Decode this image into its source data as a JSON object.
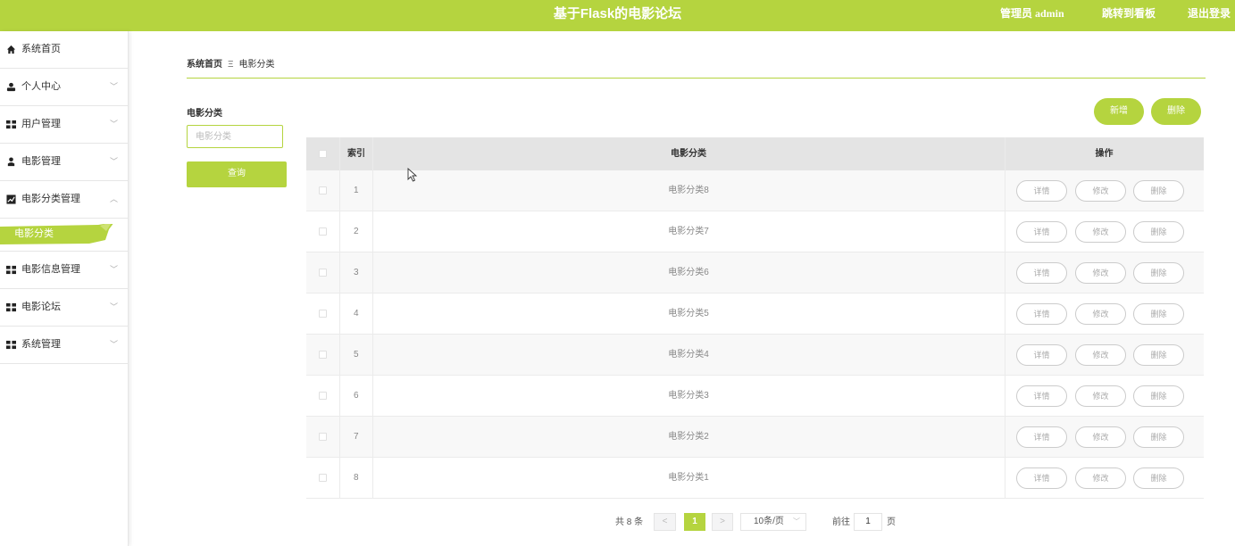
{
  "header": {
    "title": "基于Flask的电影论坛",
    "admin_label": "管理员 admin",
    "dashboard_link": "跳转到看板",
    "logout_link": "退出登录",
    "brand_color": "#b5d43f"
  },
  "sidebar": {
    "items": [
      {
        "label": "系统首页",
        "icon": "home-icon",
        "expandable": false
      },
      {
        "label": "个人中心",
        "icon": "user-icon",
        "expandable": true
      },
      {
        "label": "用户管理",
        "icon": "grid-icon",
        "expandable": true
      },
      {
        "label": "电影管理",
        "icon": "person-icon",
        "expandable": true
      },
      {
        "label": "电影分类管理",
        "icon": "chart-icon",
        "expandable": true,
        "expanded": true
      },
      {
        "label": "电影信息管理",
        "icon": "grid-icon",
        "expandable": true
      },
      {
        "label": "电影论坛",
        "icon": "grid-icon",
        "expandable": true
      },
      {
        "label": "系统管理",
        "icon": "grid-icon",
        "expandable": true
      }
    ],
    "active_sub_item": "电影分类"
  },
  "breadcrumb": {
    "home": "系统首页",
    "separator": "Ξ",
    "current": "电影分类"
  },
  "search": {
    "label": "电影分类",
    "placeholder": "电影分类",
    "value": "",
    "button_label": "查询"
  },
  "toolbar": {
    "add_label": "新增",
    "delete_label": "删除"
  },
  "table": {
    "headers": {
      "index": "索引",
      "category": "电影分类",
      "actions": "操作"
    },
    "rows": [
      {
        "index": "1",
        "category": "电影分类8"
      },
      {
        "index": "2",
        "category": "电影分类7"
      },
      {
        "index": "3",
        "category": "电影分类6"
      },
      {
        "index": "4",
        "category": "电影分类5"
      },
      {
        "index": "5",
        "category": "电影分类4"
      },
      {
        "index": "6",
        "category": "电影分类3"
      },
      {
        "index": "7",
        "category": "电影分类2"
      },
      {
        "index": "8",
        "category": "电影分类1"
      }
    ],
    "row_actions": {
      "detail": "详情",
      "edit": "修改",
      "delete": "删除"
    }
  },
  "pagination": {
    "total_text": "共 8 条",
    "prev": "<",
    "current_page": "1",
    "next": ">",
    "page_size": "10条/页",
    "goto_prefix": "前往",
    "goto_value": "1",
    "goto_suffix": "页"
  }
}
